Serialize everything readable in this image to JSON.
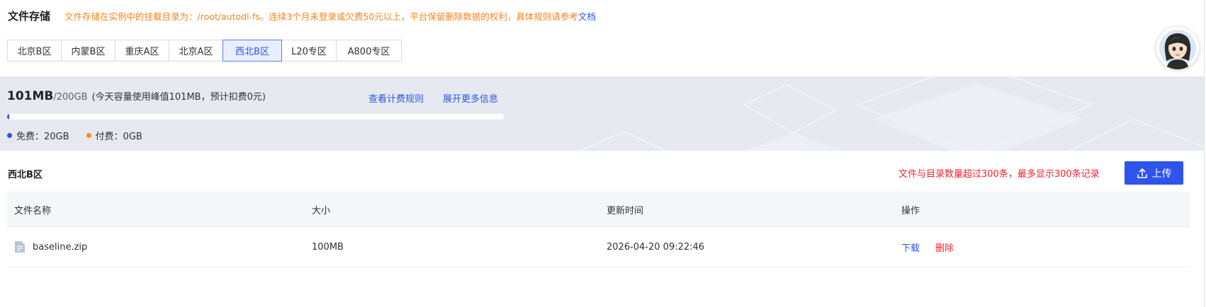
{
  "header": {
    "title": "文件存储",
    "notice": "文件存储在实例中的挂载目录为：/root/autodl-fs。连续3个月未登录或欠费50元以上，平台保留删除数据的权利，具体规则请参考",
    "notice_link": "文档"
  },
  "regions": [
    {
      "label": "北京B区",
      "active": false
    },
    {
      "label": "内蒙B区",
      "active": false
    },
    {
      "label": "重庆A区",
      "active": false
    },
    {
      "label": "北京A区",
      "active": false
    },
    {
      "label": "西北B区",
      "active": true
    },
    {
      "label": "L20专区",
      "active": false
    },
    {
      "label": "A800专区",
      "active": false
    }
  ],
  "quota": {
    "used": "101MB",
    "total": "/200GB",
    "note": "(今天容量使用峰值101MB，预计扣费0元)",
    "billing_link": "查看计费规则",
    "more_link": "展开更多信息",
    "usage_fraction": 0.0005,
    "free_label": "免费：20GB",
    "paid_label": "付费：0GB",
    "free_color": "#2f54eb",
    "paid_color": "#fa8c16"
  },
  "storage": {
    "region_title": "西北B区",
    "limit_note": "文件与目录数量超过300条，最多显示300条记录",
    "upload_label": "上传"
  },
  "table": {
    "headers": [
      "文件名称",
      "大小",
      "更新时间",
      "操作"
    ],
    "rows": [
      {
        "name": "baseline.zip",
        "size": "100MB",
        "updated": "2026-04-20 09:22:46",
        "download": "下载",
        "delete": "删除"
      }
    ]
  },
  "colors": {
    "accent": "#2f54eb",
    "warning": "#f5841f",
    "danger": "#f5222d"
  }
}
